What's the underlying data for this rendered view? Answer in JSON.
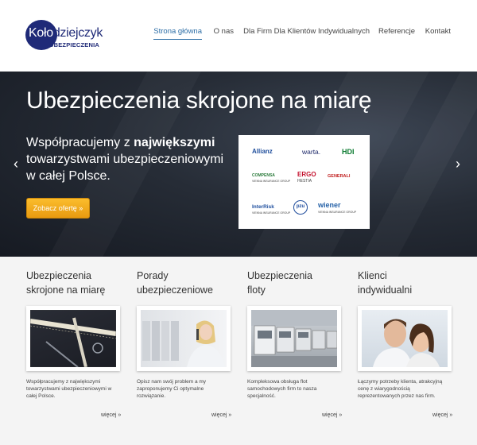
{
  "logo": {
    "part1": "Koło",
    "part2": "dziejczyk",
    "sub": "UBEZPIECZENIA"
  },
  "nav": {
    "items": [
      {
        "label": "Strona główna",
        "active": true
      },
      {
        "label": "O nas"
      },
      {
        "label": "Dla Firm"
      },
      {
        "label": "Dla Klientów Indywidualnych"
      },
      {
        "label": "Referencje"
      },
      {
        "label": "Kontakt"
      }
    ]
  },
  "hero": {
    "title": "Ubezpieczenia skrojone na miarę",
    "text_before": "Współpracujemy z ",
    "text_bold": "największymi",
    "text_after": " towarzystwami ubezpieczeniowymi w całej Polsce.",
    "button": "Zobacz ofertę »",
    "prev": "‹",
    "next": "›",
    "partners": {
      "allianz": "Allianz",
      "warta": "warta.",
      "hdi": "HDI",
      "compensa": "COMPENSA",
      "compensa_sub": "VIENNA INSURANCE GROUP",
      "ergo": "ERGO",
      "ergo_sub": "HESTIA",
      "generali": "GENERALI",
      "interrisk": "InterRisk",
      "interrisk_sub": "VIENNA INSURANCE GROUP",
      "pzu": "pzu",
      "wiener": "wiener",
      "wiener_sub": "VIENNA INSURANCE GROUP"
    }
  },
  "cards": [
    {
      "title1": "Ubezpieczenia",
      "title2": "skrojone na miarę",
      "desc": "Współpracujemy z największymi towarzystwami ubezpieczeniowymi w całej Polsce.",
      "more": "więcej »"
    },
    {
      "title1": "Porady",
      "title2": "ubezpieczeniowe",
      "desc": "Opisz nam swój problem a my zaproponujemy Ci optymalne rozwiązanie.",
      "more": "więcej »"
    },
    {
      "title1": "Ubezpieczenia",
      "title2": "floty",
      "desc": "Kompleksowa obsługa flot samochodowych firm to nasza specjalność.",
      "more": "więcej »"
    },
    {
      "title1": "Klienci",
      "title2": "indywidualni",
      "desc": "Łączymy potrzeby klienta, atrakcyjną cenę z wiarygodnością reprezentowanych przez nas firm.",
      "more": "więcej »"
    }
  ],
  "colors": {
    "brand": "#1f2a78",
    "nav_active": "#2d6ea6",
    "button": "#f2a91c"
  }
}
